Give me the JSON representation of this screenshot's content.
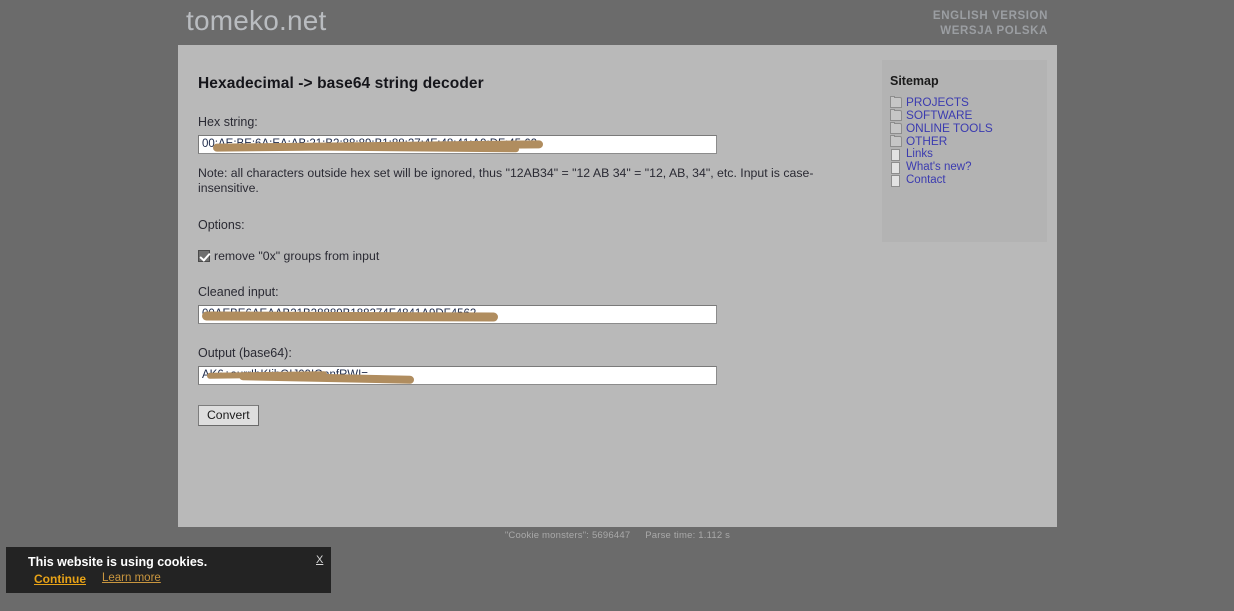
{
  "header": {
    "brand": "tomeko.net",
    "lang_links": [
      {
        "label": "ENGLISH VERSION"
      },
      {
        "label": "WERSJA POLSKA"
      }
    ]
  },
  "main": {
    "title": "Hexadecimal -> base64 string decoder",
    "hex_label": "Hex string:",
    "hex_value": "00:AE:BE:6A:EA:AB:21:B2:88:89:B1:88:27:4F:48:41:A9:DF:45:62",
    "note": "Note: all characters outside hex set will be ignored, thus \"12AB34\" = \"12 AB 34\" = \"12, AB, 34\", etc. Input is case-insensitive.",
    "options_label": "Options:",
    "option_remove_0x": "remove \"0x\" groups from input",
    "option_checked": true,
    "cleaned_label": "Cleaned input:",
    "cleaned_value": "00AEBE6AEAAB21B28889B188274F4841A9DF4562",
    "output_label": "Output (base64):",
    "output_value": "AK6+aurrIbKIibGIJ09IQanfRWI=",
    "convert_label": "Convert"
  },
  "sitemap": {
    "title": "Sitemap",
    "items": [
      {
        "label": "PROJECTS",
        "icon": "folder-icon"
      },
      {
        "label": "SOFTWARE",
        "icon": "folder-icon"
      },
      {
        "label": "ONLINE TOOLS",
        "icon": "folder-icon"
      },
      {
        "label": "OTHER",
        "icon": "folder-icon"
      },
      {
        "label": "Links",
        "icon": "page-icon"
      },
      {
        "label": "What's new?",
        "icon": "page-icon"
      },
      {
        "label": "Contact",
        "icon": "page-icon"
      }
    ]
  },
  "footer": {
    "counter": "\"Cookie monsters\": 5696447",
    "parse_time": "Parse time: 1.112 s"
  },
  "cookie_banner": {
    "title": "This website is using cookies.",
    "continue_label": "Continue",
    "learn_more_label": "Learn more",
    "close_label": "X"
  },
  "colors": {
    "page_background": "#6b6b6b",
    "panel_background": "#b9b9b9",
    "sidebar_background": "#b3b3b3",
    "link": "#3b3bb0",
    "redaction": "#b08d5f",
    "cookie_accent": "#e8a317"
  }
}
